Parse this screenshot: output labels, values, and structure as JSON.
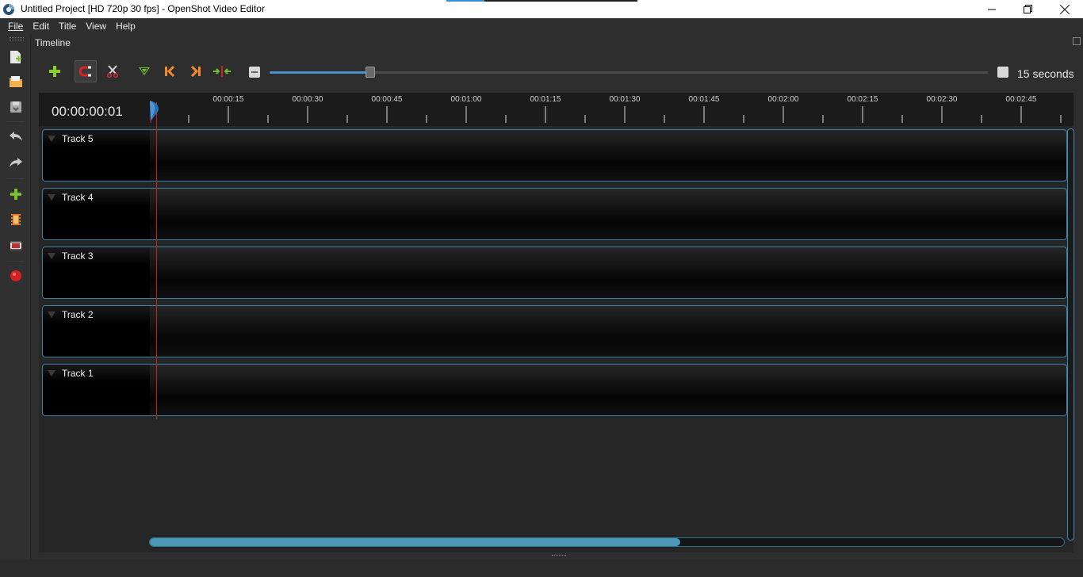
{
  "window": {
    "title": "Untitled Project [HD 720p 30 fps] - OpenShot Video Editor"
  },
  "menu": {
    "items": [
      "File",
      "Edit",
      "Title",
      "View",
      "Help"
    ]
  },
  "left_toolbar": {
    "icons": [
      "new-project-icon",
      "open-project-icon",
      "save-project-icon",
      "undo-icon",
      "redo-icon",
      "import-files-icon",
      "profile-icon",
      "export-video-icon",
      "record-icon"
    ]
  },
  "timeline": {
    "dock_title": "Timeline",
    "timecode": "00:00:00:01",
    "zoom_label": "15 seconds",
    "zoom_level": 0.14,
    "hscroll_fraction": 0.58,
    "ruler_labels": [
      "00:00:15",
      "00:00:30",
      "00:00:45",
      "00:01:00",
      "00:01:15",
      "00:01:30",
      "00:01:45",
      "00:02:00",
      "00:02:15",
      "00:02:30",
      "00:02:45"
    ],
    "tracks": [
      "Track 5",
      "Track 4",
      "Track 3",
      "Track 2",
      "Track 1"
    ],
    "toolbar_icons": [
      "add-track-icon",
      "snapping-icon",
      "razor-icon",
      "add-marker-icon",
      "previous-marker-icon",
      "next-marker-icon",
      "center-playhead-icon"
    ]
  },
  "colors": {
    "accent": "#4b8fcf",
    "track_border": "#3e7fa0",
    "playhead": "#c8242b",
    "scroll_thumb": "#4c98b6"
  }
}
